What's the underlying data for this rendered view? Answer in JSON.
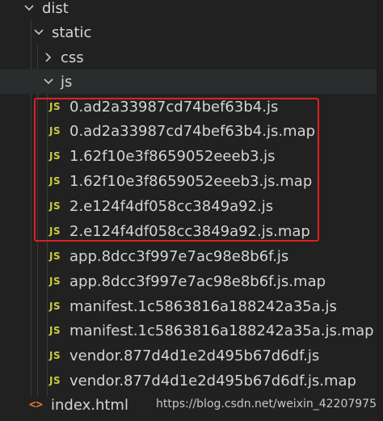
{
  "explorer": {
    "folders": {
      "dist": "dist",
      "static": "static",
      "css": "css",
      "js": "js"
    },
    "js_files": [
      "0.ad2a33987cd74bef63b4.js",
      "0.ad2a33987cd74bef63b4.js.map",
      "1.62f10e3f8659052eeeb3.js",
      "1.62f10e3f8659052eeeb3.js.map",
      "2.e124f4df058cc3849a92.js",
      "2.e124f4df058cc3849a92.js.map",
      "app.8dcc3f997e7ac98e8b6f.js",
      "app.8dcc3f997e7ac98e8b6f.js.map",
      "manifest.1c5863816a188242a35a.js",
      "manifest.1c5863816a188242a35a.js.map",
      "vendor.877d4d1e2d495b67d6df.js",
      "vendor.877d4d1e2d495b67d6df.js.map"
    ],
    "root_file": "index.html",
    "js_icon_text": "JS",
    "html_icon_text": "<>"
  },
  "watermark": "https://blog.csdn.net/weixin_42207975",
  "colors": {
    "background": "#212121",
    "text": "#d4d4d4",
    "js_icon": "#cbcb41",
    "html_icon": "#e37933",
    "highlight_box": "#e02020"
  }
}
